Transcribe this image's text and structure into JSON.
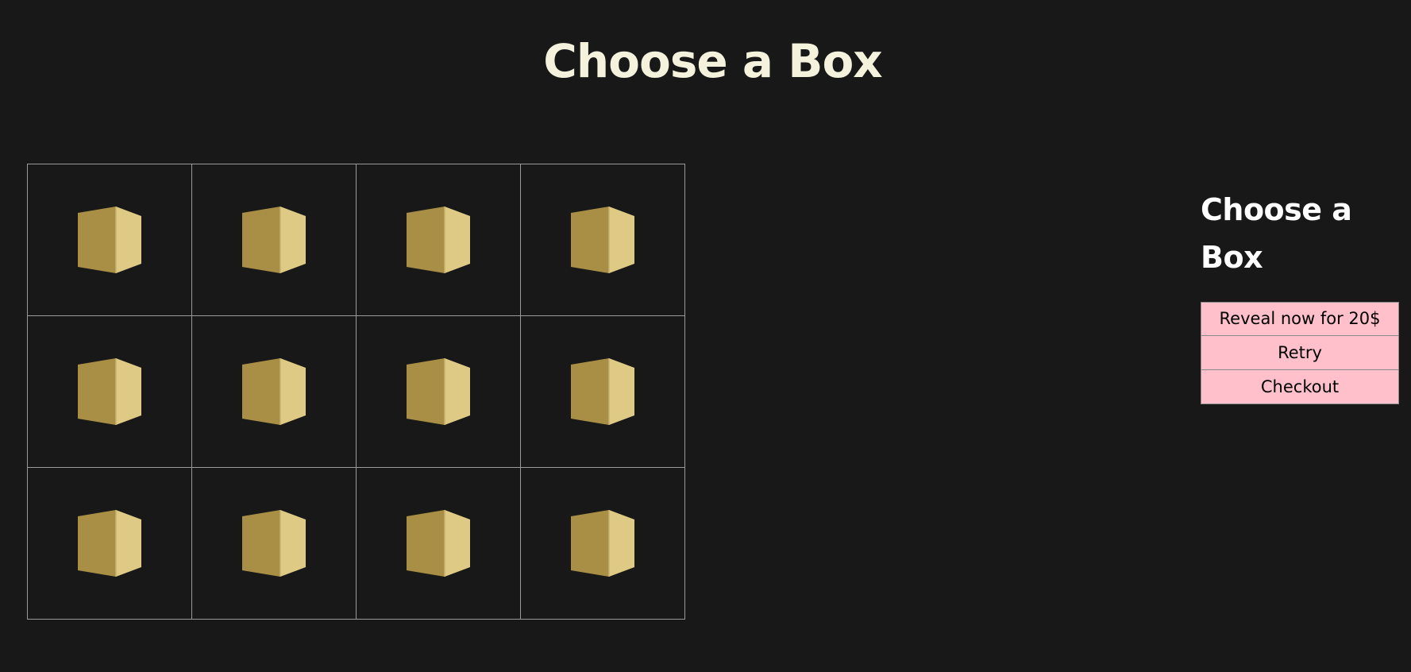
{
  "header": {
    "title": "Choose a Box"
  },
  "grid": {
    "rows": 3,
    "columns": 4,
    "box_colors": {
      "front": "#a88f45",
      "side": "#dec985",
      "edge": "#c6b26f"
    }
  },
  "sidebar": {
    "title": "Choose a Box",
    "buttons": [
      "Reveal now for 20$",
      "Retry",
      "Checkout"
    ]
  },
  "colors": {
    "background": "#181818",
    "title": "#f4f2dc",
    "button": "#ffc0cb"
  }
}
